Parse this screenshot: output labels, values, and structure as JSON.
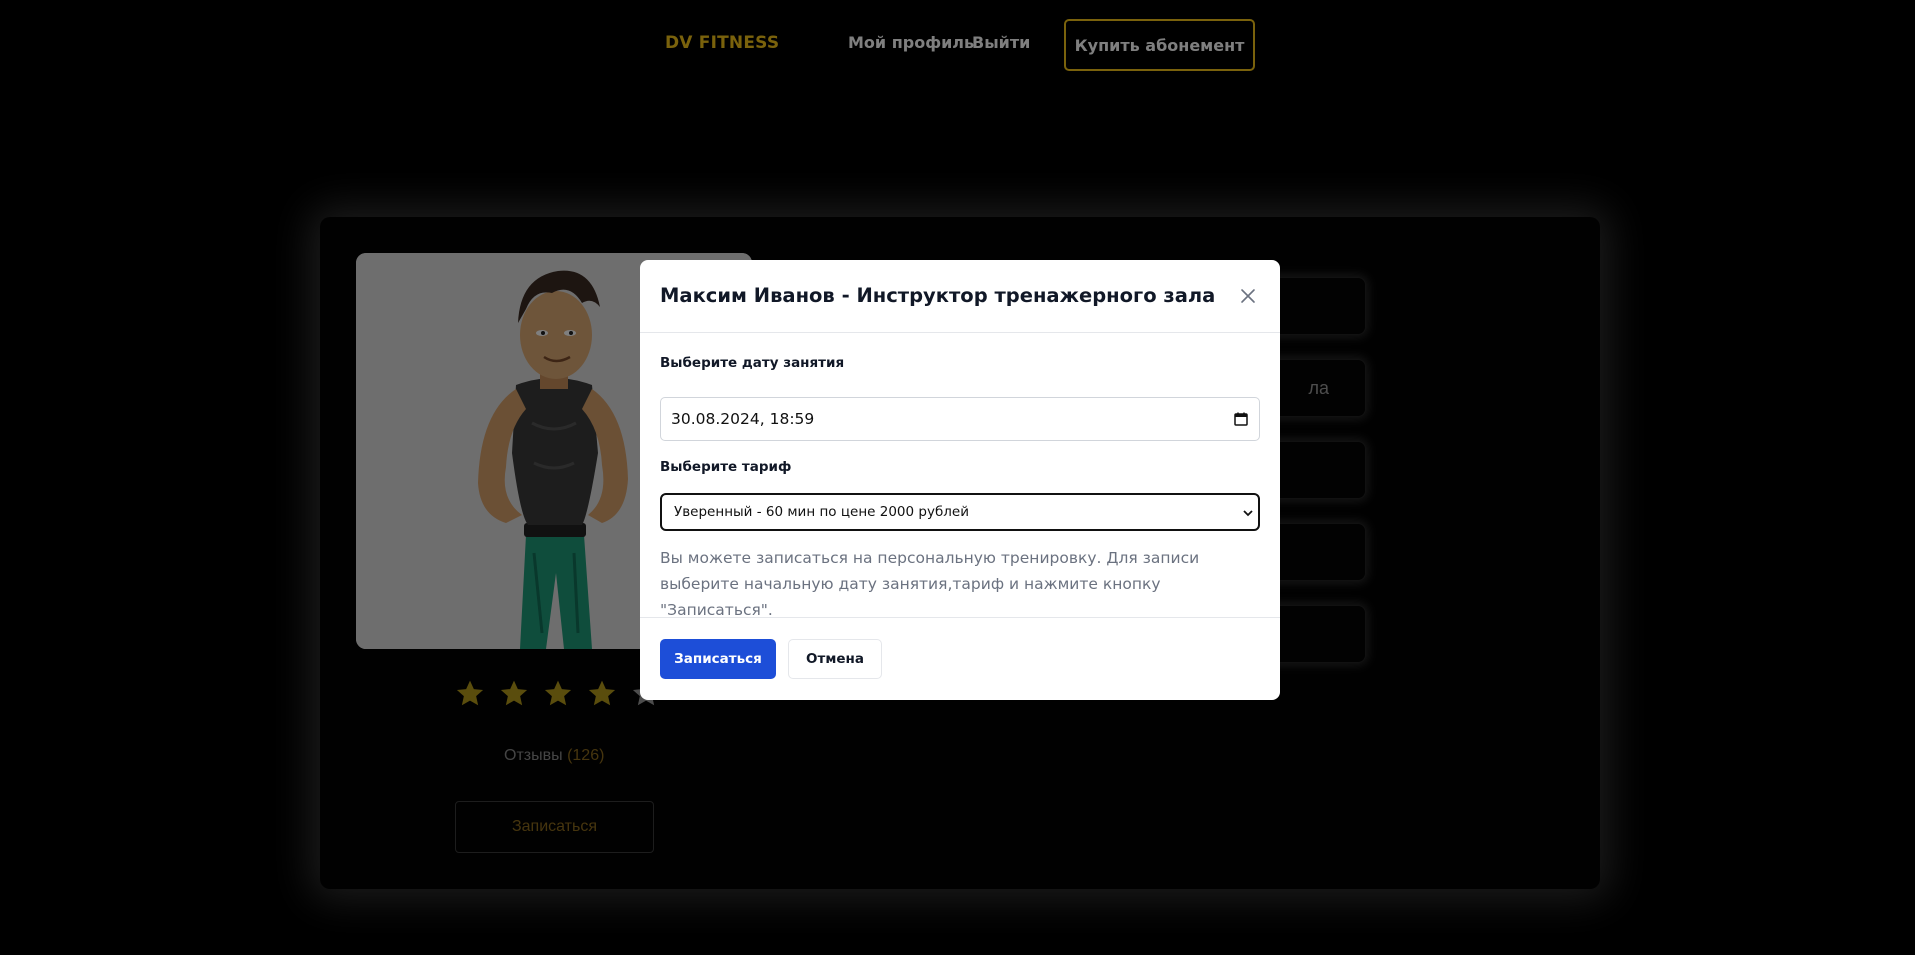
{
  "header": {
    "brand": "DV FITNESS",
    "nav_profile": "Мой профиль",
    "nav_logout": "Выйти",
    "buy_button": "Купить абонемент"
  },
  "trainer": {
    "rating_stars": 4,
    "rating_max": 5,
    "reviews_label": "Отзывы",
    "reviews_count": "(126)",
    "signup_button": "Записаться",
    "side_button_visible_text": "ла"
  },
  "modal": {
    "title": "Максим Иванов - Инструктор тренажерного зала",
    "date_label": "Выберите дату занятия",
    "date_value": "30.08.2024, 18:59",
    "tariff_label": "Выберите тариф",
    "tariff_selected": "Уверенный - 60 мин по цене 2000 рублей",
    "description": "Вы можете записаться на персональную тренировку. Для записи выберите начальную дату занятия,тариф и нажмите кнопку \"Записаться\".",
    "submit_button": "Записаться",
    "cancel_button": "Отмена"
  },
  "colors": {
    "accent": "#f5c518",
    "primary_button": "#1d4ed8"
  }
}
